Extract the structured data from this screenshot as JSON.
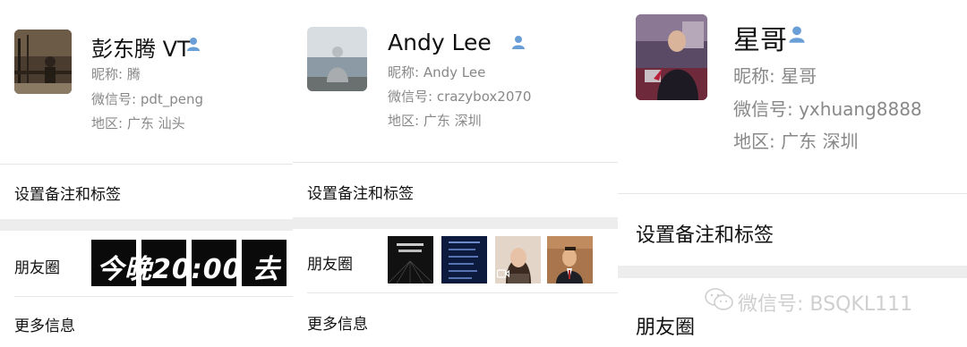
{
  "profiles": [
    {
      "name": "彭东腾 VT",
      "nickname": "昵称: 腾",
      "wechat_id": "微信号: pdt_peng",
      "region": "地区: 广东  汕头",
      "set_remark": "设置备注和标签",
      "moments": "朋友圈",
      "more_info": "更多信息",
      "moments_banner": "今晚20:00  去"
    },
    {
      "name": "Andy Lee",
      "nickname": "昵称: Andy Lee",
      "wechat_id": "微信号: crazybox2070",
      "region": "地区: 广东  深圳",
      "set_remark": "设置备注和标签",
      "moments": "朋友圈",
      "more_info": "更多信息"
    },
    {
      "name": "星哥",
      "nickname": "昵称: 星哥",
      "wechat_id": "微信号: yxhuang8888",
      "region": "地区: 广东  深圳",
      "set_remark": "设置备注和标签",
      "moments": "朋友圈"
    }
  ],
  "watermark": "微信号: BSQKL111",
  "icons": {
    "contact": "person-icon",
    "watermark": "wechat-logo-icon",
    "video": "video-camera-icon"
  },
  "colors": {
    "contact_icon": "#6a9ed6",
    "secondary_text": "#888888",
    "divider": "#e6e6e6",
    "section_gap": "#ededed"
  }
}
